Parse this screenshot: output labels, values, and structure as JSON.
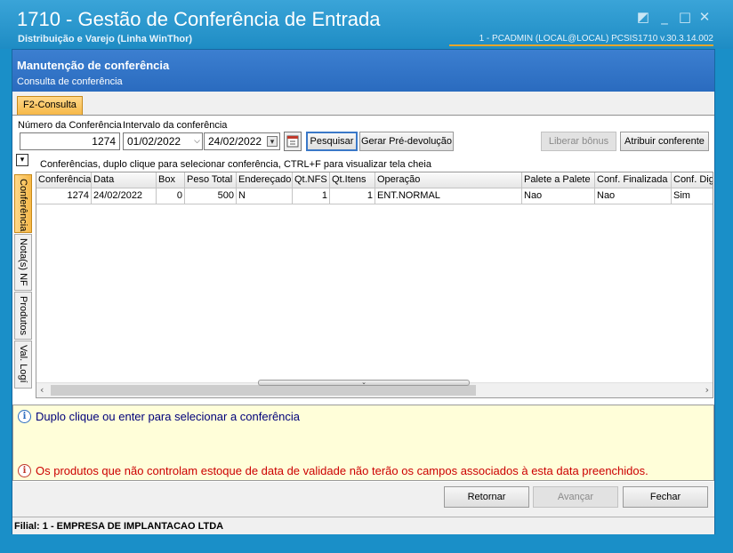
{
  "window": {
    "title": "1710 - Gestão de Conferência de Entrada",
    "subtitle": "Distribuição e Varejo (Linha WinThor)",
    "session_info": "1 - PCADMIN (LOCAL@LOCAL)   PCSIS1710  v.30.3.14.002",
    "controls": {
      "restore": "◩",
      "minimize": "_",
      "maximize": "□",
      "close": "✕"
    }
  },
  "header": {
    "title": "Manutenção de conferência",
    "subtitle": "Consulta de conferência"
  },
  "tabs": {
    "consulta": "F2-Consulta"
  },
  "filters": {
    "numero_label": "Número da Conferência",
    "intervalo_label": "Intervalo da conferência",
    "numero_value": "1274",
    "date_from": "01/02/2022",
    "date_to": "24/02/2022",
    "pesquisar": "Pesquisar",
    "gerar": "Gerar Pré-devolução",
    "liberar": "Liberar bônus",
    "atribuir": "Atribuir conferente"
  },
  "side_tabs": {
    "conferencia": "Conferência",
    "notas": "Nota(s) NF",
    "produtos": "Produtos",
    "val_logi": "Val. Logí"
  },
  "grid": {
    "hint": "Conferências, duplo clique para selecionar conferência, CTRL+F para visualizar tela cheia",
    "columns": [
      "Conferência",
      "Data",
      "Box",
      "Peso Total",
      "Endereçado",
      "Qt.NFS",
      "Qt.Itens",
      "Operação",
      "Palete a Palete",
      "Conf. Finalizada",
      "Conf. Dig"
    ],
    "row": [
      "1274",
      "24/02/2022",
      "0",
      "500",
      "N",
      "1",
      "1",
      "ENT.NORMAL",
      "Nao",
      "Nao",
      "Sim"
    ]
  },
  "info": {
    "msg1": "Duplo clique ou enter para selecionar a conferência",
    "msg2": "Os produtos que não controlam estoque de data de validade não terão os campos associados à esta data preenchidos."
  },
  "buttons": {
    "retornar": "Retornar",
    "avancar": "Avançar",
    "fechar": "Fechar"
  },
  "status": {
    "filial": "Filial: 1 - EMPRESA DE IMPLANTACAO LTDA"
  },
  "colors": {
    "accent": "#2a6bbf",
    "titlebar": "#1e8cc4",
    "tab_active": "#f6b847",
    "warning_text": "#cc0000",
    "info_text": "#00007a"
  }
}
